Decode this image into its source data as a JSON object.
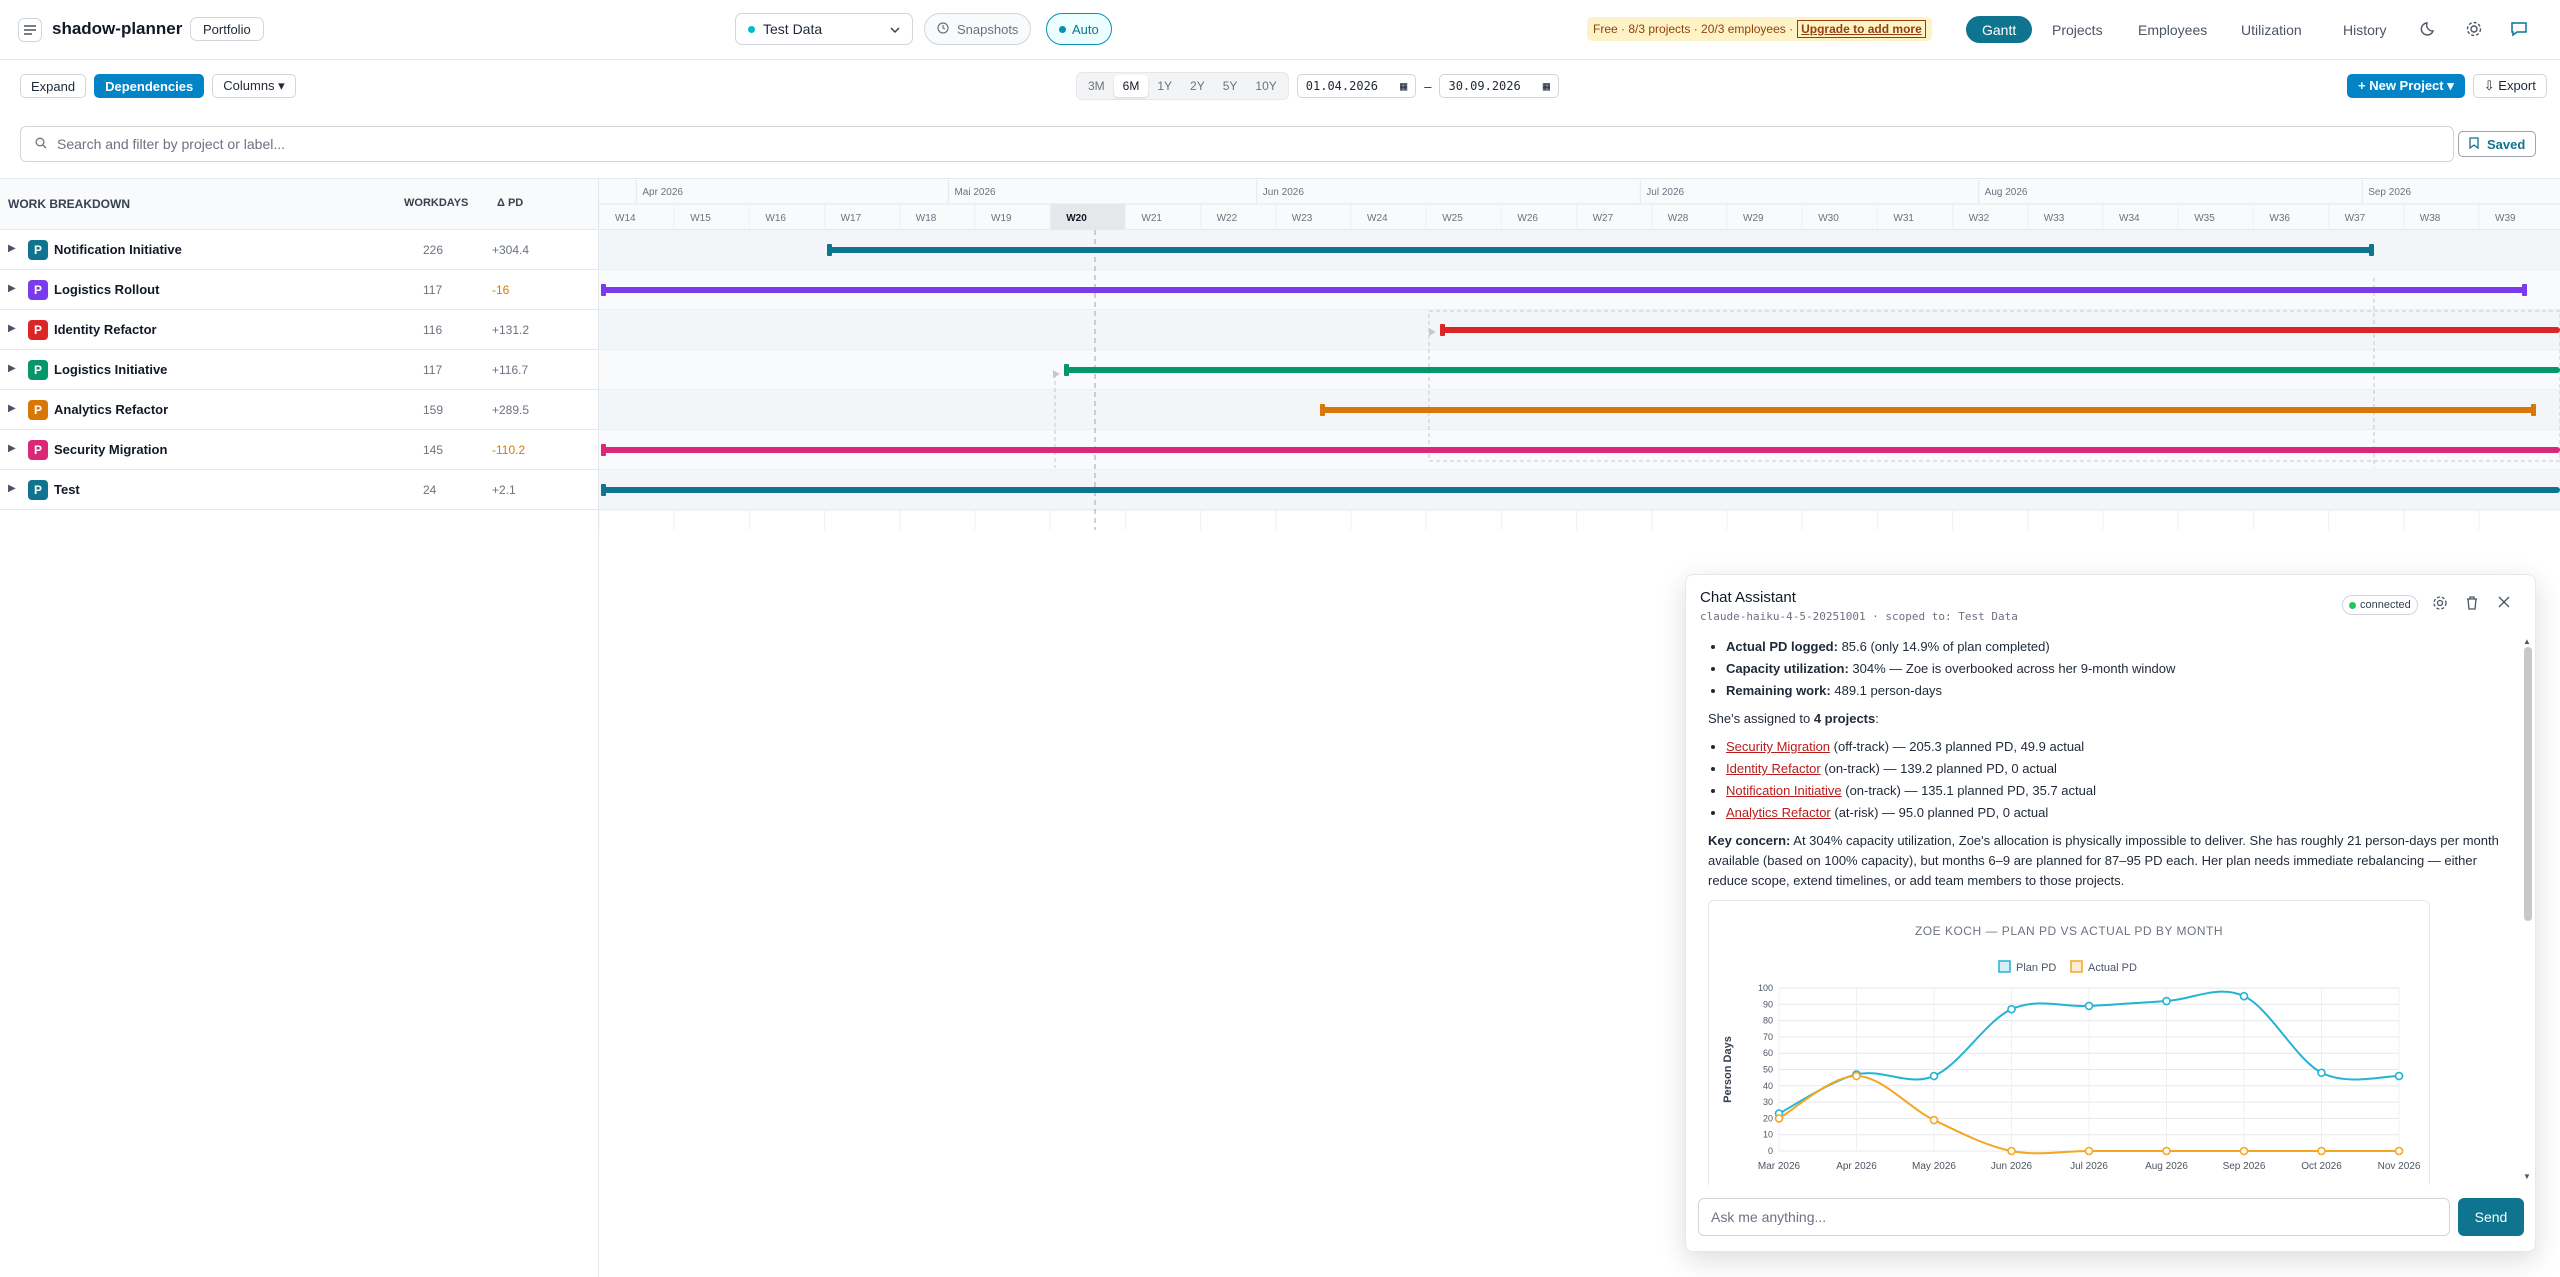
{
  "app": {
    "name": "shadow-planner",
    "portfolio_label": "Portfolio"
  },
  "header": {
    "dataset": "Test Data",
    "snapshots_label": "Snapshots",
    "auto_label": "Auto",
    "plan_notice": "Free · 8/3 projects · 20/3 employees ·",
    "upgrade_label": "Upgrade to add more",
    "nav": [
      "Gantt",
      "Projects",
      "Employees",
      "Utilization",
      "History"
    ],
    "active_nav": "Gantt"
  },
  "toolbar": {
    "expand_label": "Expand",
    "dependencies_label": "Dependencies",
    "columns_label": "Columns ▾",
    "ranges": [
      "3M",
      "6M",
      "1Y",
      "2Y",
      "5Y",
      "10Y"
    ],
    "active_range": "6M",
    "date_from": "01.04.2026",
    "date_to": "30.09.2026",
    "date_separator": "–",
    "new_project_label": "+ New Project ▾",
    "export_label": "⇩ Export"
  },
  "search": {
    "placeholder": "Search and filter by project or label...",
    "saved_label": "Saved"
  },
  "table": {
    "col_breakdown": "WORK BREAKDOWN",
    "col_workdays": "WORKDAYS",
    "col_delta": "Δ PD"
  },
  "timeline": {
    "months": [
      "Apr 2026",
      "Mai 2026",
      "Jun 2026",
      "Jul 2026",
      "Aug 2026",
      "Sep 2026"
    ],
    "weeks": [
      "W14",
      "W15",
      "W16",
      "W17",
      "W18",
      "W19",
      "W20",
      "W21",
      "W22",
      "W23",
      "W24",
      "W25",
      "W26",
      "W27",
      "W28",
      "W29",
      "W30",
      "W31",
      "W32",
      "W33",
      "W34",
      "W35",
      "W36",
      "W37",
      "W38",
      "W39"
    ],
    "current_week": "W20"
  },
  "projects": [
    {
      "name": "Notification Initiative",
      "badge": "P",
      "color": "#0e7490",
      "workdays": "226",
      "delta": "+304.4",
      "delta_color": "#6b7280"
    },
    {
      "name": "Logistics Rollout",
      "badge": "P",
      "color": "#7c3aed",
      "workdays": "117",
      "delta": "-16",
      "delta_color": "#d97706"
    },
    {
      "name": "Identity Refactor",
      "badge": "P",
      "color": "#dc2626",
      "workdays": "116",
      "delta": "+131.2",
      "delta_color": "#6b7280"
    },
    {
      "name": "Logistics Initiative",
      "badge": "P",
      "color": "#059669",
      "workdays": "117",
      "delta": "+116.7",
      "delta_color": "#6b7280"
    },
    {
      "name": "Analytics Refactor",
      "badge": "P",
      "color": "#d97706",
      "workdays": "159",
      "delta": "+289.5",
      "delta_color": "#6b7280"
    },
    {
      "name": "Security Migration",
      "badge": "P",
      "color": "#db2777",
      "workdays": "145",
      "delta": "-110.2",
      "delta_color": "#d97706"
    },
    {
      "name": "Test",
      "badge": "P",
      "color": "#0e7490",
      "workdays": "24",
      "delta": "+2.1",
      "delta_color": "#6b7280"
    }
  ],
  "chat": {
    "title": "Chat Assistant",
    "model": "claude-haiku-4-5-20251001 · scoped to: Test Data",
    "status": "connected",
    "bullets_top": [
      {
        "label": "Actual PD logged:",
        "text": " 85.6 (only 14.9% of plan completed)"
      },
      {
        "label": "Capacity utilization:",
        "text": " 304% — Zoe is overbooked across her 9-month window"
      },
      {
        "label": "Remaining work:",
        "text": " 489.1 person-days"
      }
    ],
    "assigned_prefix": "She's assigned to ",
    "assigned_count": "4 projects",
    "assigned_suffix": ":",
    "project_lines": [
      {
        "link": "Security Migration",
        "text": " (off-track) — 205.3 planned PD, 49.9 actual"
      },
      {
        "link": "Identity Refactor",
        "text": " (on-track) — 139.2 planned PD, 0 actual"
      },
      {
        "link": "Notification Initiative",
        "text": " (on-track) — 135.1 planned PD, 35.7 actual"
      },
      {
        "link": "Analytics Refactor",
        "text": " (at-risk) — 95.0 planned PD, 0 actual"
      }
    ],
    "concern_label": "Key concern:",
    "concern_text": " At 304% capacity utilization, Zoe's allocation is physically impossible to deliver. She has roughly 21 person-days per month available (based on 100% capacity), but months 6–9 are planned for 87–95 PD each. Her plan needs immediate rebalancing — either reduce scope, extend timelines, or add team members to those projects.",
    "input_placeholder": "Ask me anything...",
    "send_label": "Send"
  },
  "chart_data": {
    "type": "line",
    "title": "ZOE KOCH — PLAN PD VS ACTUAL PD BY MONTH",
    "xlabel": "",
    "ylabel": "Person Days",
    "categories": [
      "Mar 2026",
      "Apr 2026",
      "May 2026",
      "Jun 2026",
      "Jul 2026",
      "Aug 2026",
      "Sep 2026",
      "Oct 2026",
      "Nov 2026"
    ],
    "series": [
      {
        "name": "Plan PD",
        "color": "#22b4d4",
        "values": [
          23,
          47,
          46,
          87,
          89,
          92,
          95,
          48,
          46
        ]
      },
      {
        "name": "Actual PD",
        "color": "#f5a623",
        "values": [
          20,
          46,
          19,
          0,
          0,
          0,
          0,
          0,
          0
        ]
      }
    ],
    "ylim": [
      0,
      100
    ],
    "yticks": [
      0,
      10,
      20,
      30,
      40,
      50,
      60,
      70,
      80,
      90,
      100
    ],
    "grid": true,
    "legend": "top"
  }
}
